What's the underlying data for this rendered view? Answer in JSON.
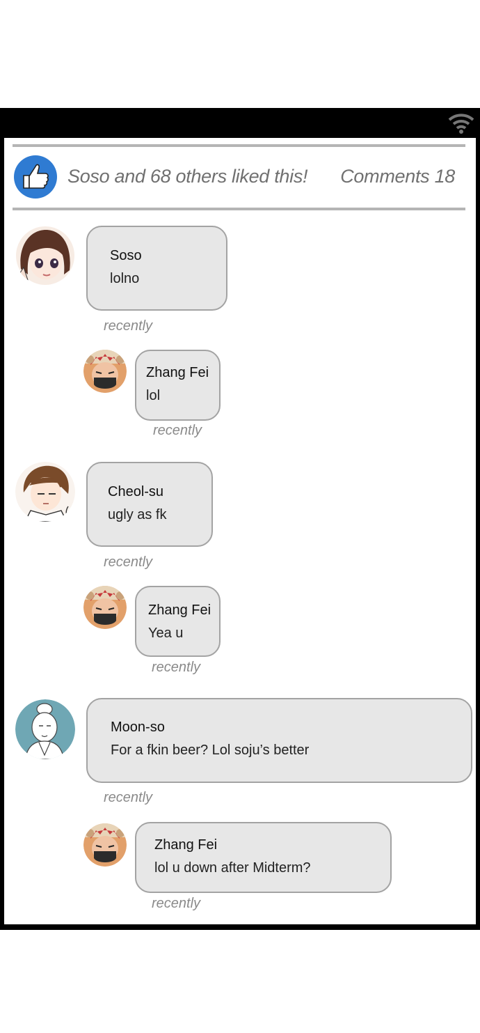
{
  "post": {
    "liked_by": "Soso",
    "liked_suffix": " and 68 others liked this!",
    "comments_label": "Comments 18"
  },
  "icons": {
    "wifi": "wifi-icon",
    "like": "thumbs-up-icon"
  },
  "colors": {
    "like_accent": "#2f7bd2",
    "bubble_bg": "#e7e7e7",
    "bubble_border": "#a3a3a3",
    "timestamp": "#8a8a8a",
    "divider": "#b5b5b5"
  },
  "comments": [
    {
      "author": "Soso",
      "text": "lolno",
      "time": "recently"
    },
    {
      "author": "Zhang Fei",
      "text": "lol",
      "time": "recently"
    },
    {
      "author": "Cheol-su",
      "text": "ugly as fk",
      "time": "recently"
    },
    {
      "author": "Zhang Fei",
      "text": "Yea u",
      "time": "recently"
    },
    {
      "author": "Moon-so",
      "text": "For a fkin beer? Lol soju’s better",
      "time": "recently"
    },
    {
      "author": "Zhang Fei",
      "text": "lol u down after Midterm?",
      "time": "recently"
    }
  ]
}
